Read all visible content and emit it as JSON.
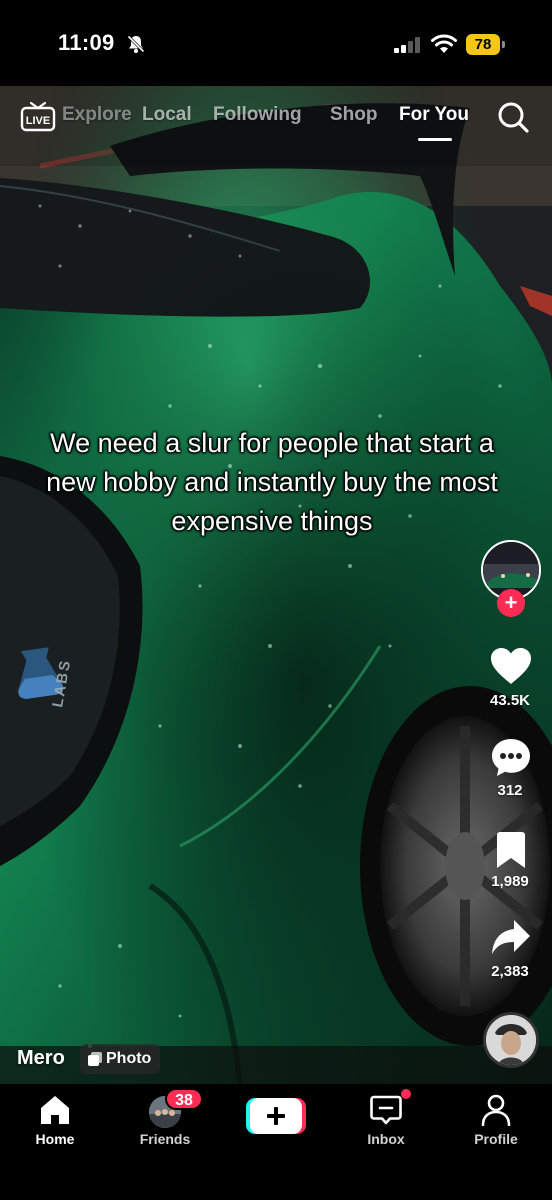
{
  "status_bar": {
    "time": "11:09",
    "battery": "78"
  },
  "top_nav": {
    "live_label": "LIVE",
    "tabs": [
      {
        "label": "Explore"
      },
      {
        "label": "Local"
      },
      {
        "label": "Following"
      },
      {
        "label": "Shop"
      },
      {
        "label": "For You"
      }
    ],
    "active_tab": "For You"
  },
  "post": {
    "caption": "We need a slur for people that start a new hobby and instantly buy the most expensive things",
    "watermark_text": "LABS",
    "author": "Mero",
    "media_type_label": "Photo"
  },
  "actions": {
    "likes": "43.5K",
    "comments": "312",
    "saves": "1,989",
    "shares": "2,383"
  },
  "bottom_nav": {
    "home": "Home",
    "friends": "Friends",
    "friends_badge": "38",
    "inbox": "Inbox",
    "profile": "Profile"
  },
  "colors": {
    "accent": "#fe2c55",
    "battery": "#f5c518",
    "car_paint": "#0f6b42",
    "create_cyan": "#25f4ee"
  }
}
